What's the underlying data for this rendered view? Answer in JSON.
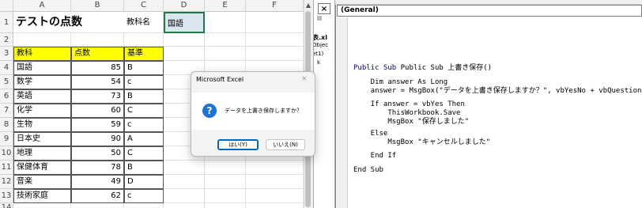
{
  "excel": {
    "columns": [
      "A",
      "B",
      "C",
      "D",
      "E",
      "F"
    ],
    "rows": [
      "1",
      "2",
      "3",
      "4",
      "5",
      "6",
      "7",
      "8",
      "9",
      "10",
      "11",
      "12",
      "13",
      "14"
    ],
    "title": "テストの点数",
    "subject_label": "教科名",
    "subject_value": "国語",
    "table_headers": [
      "教科",
      "点数",
      "基準"
    ],
    "table_rows": [
      [
        "国語",
        "85",
        "B"
      ],
      [
        "数学",
        "54",
        "c"
      ],
      [
        "英語",
        "73",
        "B"
      ],
      [
        "化学",
        "60",
        "C"
      ],
      [
        "生物",
        "59",
        "c"
      ],
      [
        "日本史",
        "90",
        "A"
      ],
      [
        "地理",
        "50",
        "C"
      ],
      [
        "保健体育",
        "78",
        "B"
      ],
      [
        "音楽",
        "49",
        "D"
      ],
      [
        "技術家庭",
        "62",
        "c"
      ]
    ]
  },
  "strip": {
    "close": "×",
    "lines": [
      "表.xl",
      "Objec",
      "et1)",
      "k"
    ]
  },
  "vbe": {
    "object_combo": "(General)",
    "code": {
      "sub_decl": "Public Sub 上書き保存()",
      "dim_line": "    Dim answer As Long",
      "msgbox_line": "    answer = MsgBox(\"データを上書き保存しますか？\", vbYesNo + vbQuestion)",
      "if_line": "    If answer = vbYes Then",
      "save_line": "        ThisWorkbook.Save",
      "msg_saved": "        MsgBox \"保存しました\"",
      "else_line": "    Else",
      "msg_cancel": "        MsgBox \"キャンセルしました\"",
      "endif_line": "    End If",
      "endsub_line": "End Sub"
    }
  },
  "dialog": {
    "title": "Microsoft Excel",
    "close": "×",
    "icon": "?",
    "message": "データを上書き保存しますか？",
    "yes": "はい(Y)",
    "no": "いいえ(N)"
  }
}
